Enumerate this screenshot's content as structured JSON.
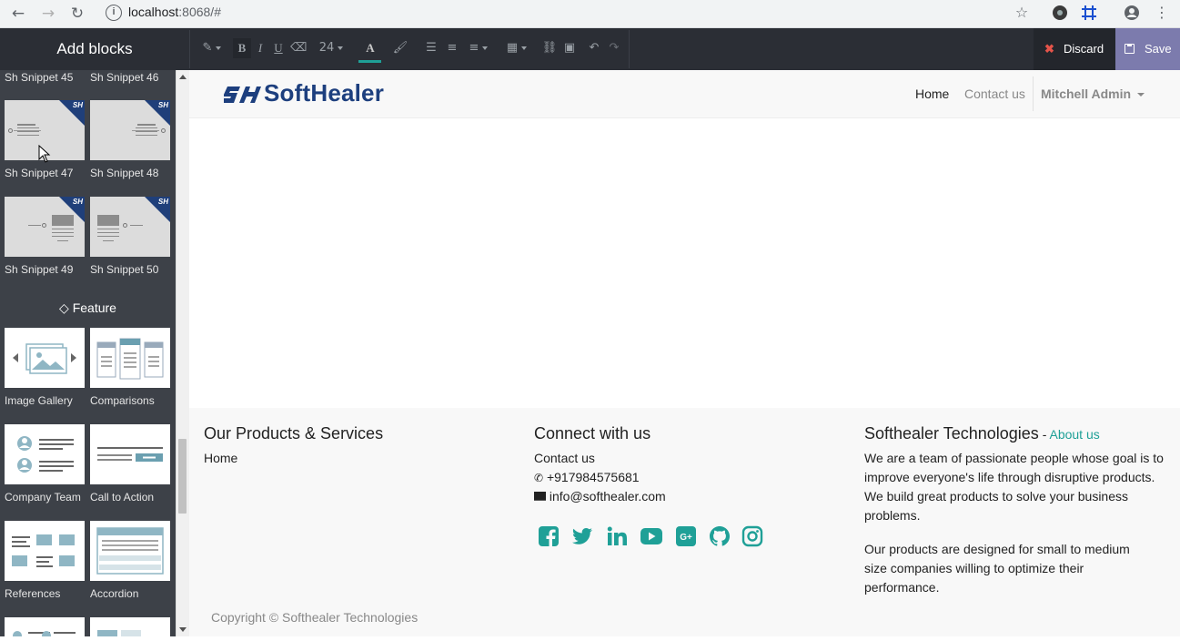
{
  "browser": {
    "url_host": "localhost",
    "url_rest": ":8068/#"
  },
  "sidebar": {
    "title": "Add blocks",
    "snippets": [
      {
        "label": "Sh Snippet 45"
      },
      {
        "label": "Sh Snippet 46"
      },
      {
        "label": "Sh Snippet 47"
      },
      {
        "label": "Sh Snippet 48"
      },
      {
        "label": "Sh Snippet 49"
      },
      {
        "label": "Sh Snippet 50"
      }
    ],
    "badge": "SH",
    "feature_heading": "Feature",
    "features": [
      {
        "label": "Image Gallery"
      },
      {
        "label": "Comparisons"
      },
      {
        "label": "Company Team"
      },
      {
        "label": "Call to Action"
      },
      {
        "label": "References"
      },
      {
        "label": "Accordion"
      }
    ]
  },
  "toolbar": {
    "font_size": "24",
    "discard_label": "Discard",
    "save_label": "Save"
  },
  "site": {
    "logo_text": "SoftHealer",
    "nav": {
      "home": "Home",
      "contact": "Contact us",
      "user": "Mitchell Admin"
    },
    "footer": {
      "col1_title": "Our Products & Services",
      "col1_link": "Home",
      "col2_title": "Connect with us",
      "col2_link": "Contact us",
      "phone": "+917984575681",
      "email": "info@softhealer.com",
      "col3_title": "Softhealer Technologies",
      "col3_sep": " - ",
      "col3_link": "About us",
      "para1": "We are a team of passionate people whose goal is to improve everyone's life through disruptive products. We build great products to solve your business problems.",
      "para2": "Our products are designed for small to medium size companies willing to optimize their performance.",
      "copyright": "Copyright © Softhealer Technologies"
    },
    "social_icons": [
      "facebook-icon",
      "twitter-icon",
      "linkedin-icon",
      "youtube-icon",
      "google-plus-icon",
      "github-icon",
      "instagram-icon"
    ]
  },
  "colors": {
    "accent": "#1fa097",
    "editor_bar": "#2b2e35",
    "sidebar": "#3d4148",
    "save": "#7c7bad",
    "logo": "#1d3f7e"
  }
}
